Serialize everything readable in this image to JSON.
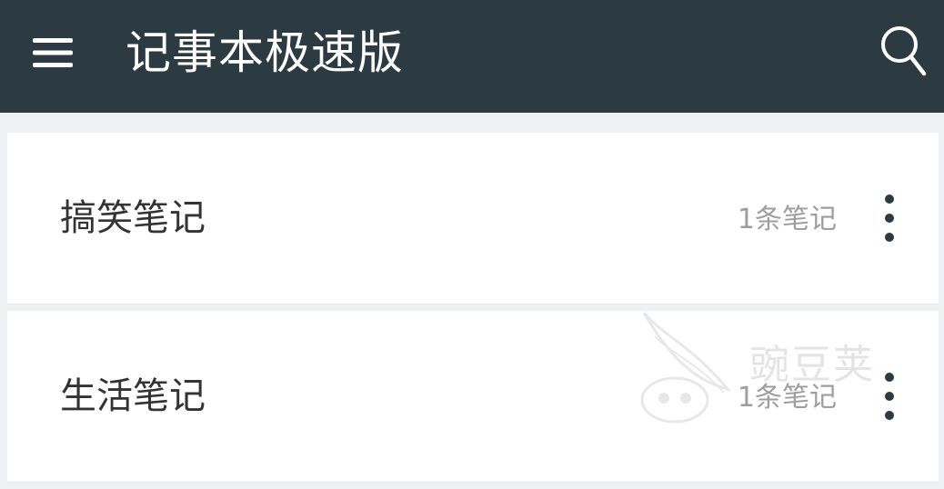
{
  "appbar": {
    "title": "记事本极速版",
    "menu_icon": "hamburger-menu-icon",
    "search_icon": "search-icon",
    "background": "#2c3a41",
    "title_color": "#ffffff"
  },
  "notebooks": [
    {
      "name": "搞笑笔记",
      "count": "1条笔记"
    },
    {
      "name": "生活笔记",
      "count": "1条笔记"
    }
  ],
  "watermark": {
    "text": "豌豆荚"
  },
  "colors": {
    "background": "#eef1f2",
    "card": "#ffffff",
    "name_text": "#333333",
    "count_text": "#9e9e9e",
    "icon_dark": "#2c3a41"
  }
}
